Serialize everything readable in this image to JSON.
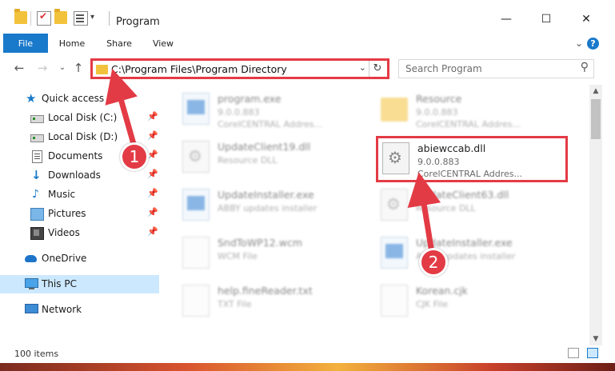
{
  "window": {
    "title": "Program",
    "controls": {
      "minimize": "—",
      "maximize": "☐",
      "close": "✕"
    }
  },
  "ribbon": {
    "tabs": [
      "File",
      "Home",
      "Share",
      "View"
    ],
    "collapse_glyph": "⌄",
    "help_glyph": "?"
  },
  "nav": {
    "back": "←",
    "forward": "→",
    "recent": "⌄",
    "up": "↑",
    "address": "C:\\Program Files\\Program Directory",
    "address_dropdown": "⌄",
    "refresh": "↻",
    "search_placeholder": "Search Program",
    "search_glyph": "⚲"
  },
  "sidebar": {
    "items": [
      {
        "label": "Quick access",
        "icon": "star-icon",
        "pinned": false
      },
      {
        "label": "Local Disk (C:)",
        "icon": "disk-icon",
        "pinned": true
      },
      {
        "label": "Local Disk (D:)",
        "icon": "disk-icon",
        "pinned": true
      },
      {
        "label": "Documents",
        "icon": "documents-icon",
        "pinned": true
      },
      {
        "label": "Downloads",
        "icon": "downloads-icon",
        "pinned": true
      },
      {
        "label": "Music",
        "icon": "music-icon",
        "pinned": true
      },
      {
        "label": "Pictures",
        "icon": "pictures-icon",
        "pinned": true
      },
      {
        "label": "Videos",
        "icon": "videos-icon",
        "pinned": true
      },
      {
        "label": "OneDrive",
        "icon": "onedrive-icon",
        "pinned": false
      },
      {
        "label": "This PC",
        "icon": "pc-icon",
        "pinned": false,
        "selected": true
      },
      {
        "label": "Network",
        "icon": "network-icon",
        "pinned": false
      }
    ],
    "pin_glyph": "📌",
    "star_glyph": "★",
    "download_glyph": "↓",
    "music_glyph": "♪"
  },
  "files": [
    {
      "name": "program.exe",
      "line2": "9.0.0.883",
      "line3": "CorelCENTRAL Addres...",
      "type": "exe",
      "focus": false
    },
    {
      "name": "Resource",
      "line2": "9.0.0.883",
      "line3": "CorelCENTRAL Addres...",
      "type": "folder",
      "focus": false
    },
    {
      "name": "UpdateClient19.dll",
      "line2": "Resource DLL",
      "line3": "",
      "type": "dll",
      "focus": false
    },
    {
      "name": "abiewccab.dll",
      "line2": "9.0.0.883",
      "line3": "CorelCENTRAL Addres...",
      "type": "dll",
      "focus": true
    },
    {
      "name": "UpdateInstaller.exe",
      "line2": "ABBY updates installer",
      "line3": "",
      "type": "exe",
      "focus": false
    },
    {
      "name": "UpdateClient63.dll",
      "line2": "Resource DLL",
      "line3": "",
      "type": "dll",
      "focus": false
    },
    {
      "name": "SndToWP12.wcm",
      "line2": "WCM File",
      "line3": "",
      "type": "file",
      "focus": false
    },
    {
      "name": "UpdateInstaller.exe",
      "line2": "ABBY updates installer",
      "line3": "",
      "type": "exe",
      "focus": false
    },
    {
      "name": "help.fineReader.txt",
      "line2": "TXT File",
      "line3": "",
      "type": "file",
      "focus": false
    },
    {
      "name": "Korean.cjk",
      "line2": "CJK File",
      "line3": "",
      "type": "file",
      "focus": false
    }
  ],
  "scrollbar": {
    "up": "▲",
    "down": "▼"
  },
  "status": {
    "item_count": "100 items"
  },
  "annotations": {
    "step1": "1",
    "step2": "2",
    "color": "#e33b45"
  },
  "colors": {
    "accent": "#1979ca",
    "highlight": "#e33b45",
    "selected": "#cce8ff"
  }
}
